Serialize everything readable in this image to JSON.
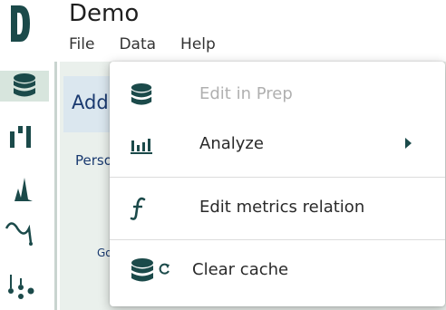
{
  "app": {
    "title": "Demo"
  },
  "menubar": {
    "items": [
      "File",
      "Data",
      "Help"
    ]
  },
  "main": {
    "card_label": "Add",
    "section_label": "Perso",
    "small_label": "Go"
  },
  "dropdown": {
    "items": [
      {
        "label": "Edit in Prep",
        "icon": "database-icon",
        "disabled": true
      },
      {
        "label": "Analyze",
        "icon": "bar-chart-icon",
        "submenu": true
      },
      {
        "label": "Edit metrics relation",
        "icon": "function-icon"
      },
      {
        "label": "Clear cache",
        "icon": "database-refresh-icon"
      }
    ]
  },
  "sidebar": {
    "items": [
      "database-icon",
      "columns-icon",
      "distribution-icon",
      "curve-icon",
      "scatter-icon"
    ]
  },
  "colors": {
    "icon": "#1b4a4a",
    "accent": "#d7e5dd",
    "panel": "#eaf0ec"
  }
}
